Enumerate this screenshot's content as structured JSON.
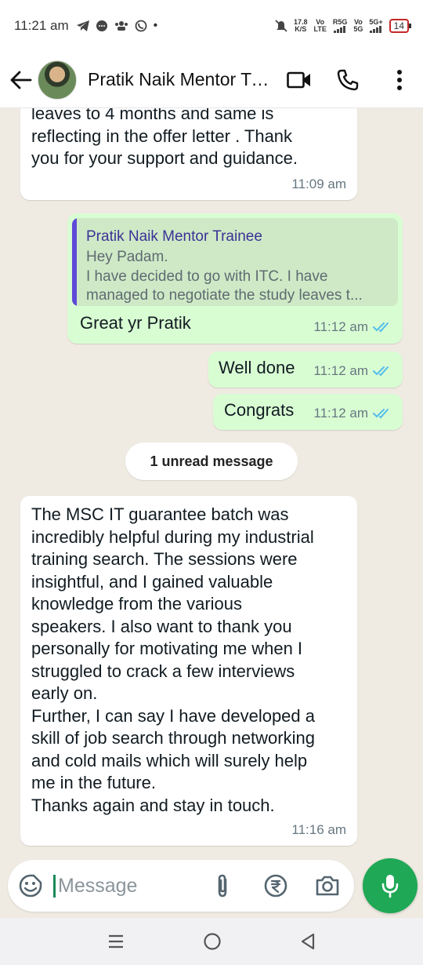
{
  "status_bar": {
    "time": "11:21 am",
    "net_speed": "17.8",
    "net_unit": "K/S",
    "sim1_top": "Vo",
    "sim1_bottom": "LTE",
    "sim1_label": "R5G",
    "sim2_top": "Vo",
    "sim2_bottom": "5G",
    "sim2_label": "5G+",
    "battery": "14",
    "dot": "•"
  },
  "header": {
    "contact_name": "Pratik Naik Mentor Trainee",
    "icons": [
      "back-arrow-icon",
      "video-call-icon",
      "phone-icon",
      "more-options-icon"
    ]
  },
  "messages": [
    {
      "direction": "incoming",
      "lines": [
        "leaves to 4 months and same is",
        "reflecting in the offer letter . Thank",
        "you for your support and guidance."
      ],
      "time": "11:09 am"
    },
    {
      "direction": "outgoing",
      "quoted": {
        "author": "Pratik Naik Mentor Trainee",
        "lines": [
          "Hey Padam.",
          "I have decided to go with ITC. I have",
          "managed to negotiate the study leaves t..."
        ]
      },
      "text": "Great yr Pratik",
      "time": "11:12 am"
    },
    {
      "direction": "outgoing",
      "text": "Well done",
      "time": "11:12 am"
    },
    {
      "direction": "outgoing",
      "text": "Congrats",
      "time": "11:12 am"
    },
    {
      "direction": "incoming",
      "lines": [
        "The MSC IT guarantee batch was",
        "incredibly helpful during my industrial",
        "training search. The sessions were",
        "insightful, and I gained valuable",
        "knowledge from the various",
        "speakers. I also want to thank you",
        "personally for motivating me when I",
        "struggled to crack a few interviews",
        "early on.",
        "Further, I can say I have developed a",
        "skill of job search through networking",
        "and cold mails which will surely help",
        "me in the future.",
        "Thanks again and stay in touch."
      ],
      "time": "11:16 am"
    }
  ],
  "unread_banner": "1 unread message",
  "composer": {
    "placeholder": "Message",
    "icons": [
      "emoji-sticker-icon",
      "attach-icon",
      "rupee-payment-icon",
      "camera-icon",
      "mic-icon"
    ]
  },
  "nav_bar": {
    "icons": [
      "recent-apps-icon",
      "home-icon",
      "back-nav-icon"
    ]
  },
  "colors": {
    "incoming_bubble": "#ffffff",
    "outgoing_bubble": "#d9fdd3",
    "read_ticks": "#53bdeb",
    "accent_green": "#1fa855",
    "quote_bar": "#5e4ad8"
  }
}
